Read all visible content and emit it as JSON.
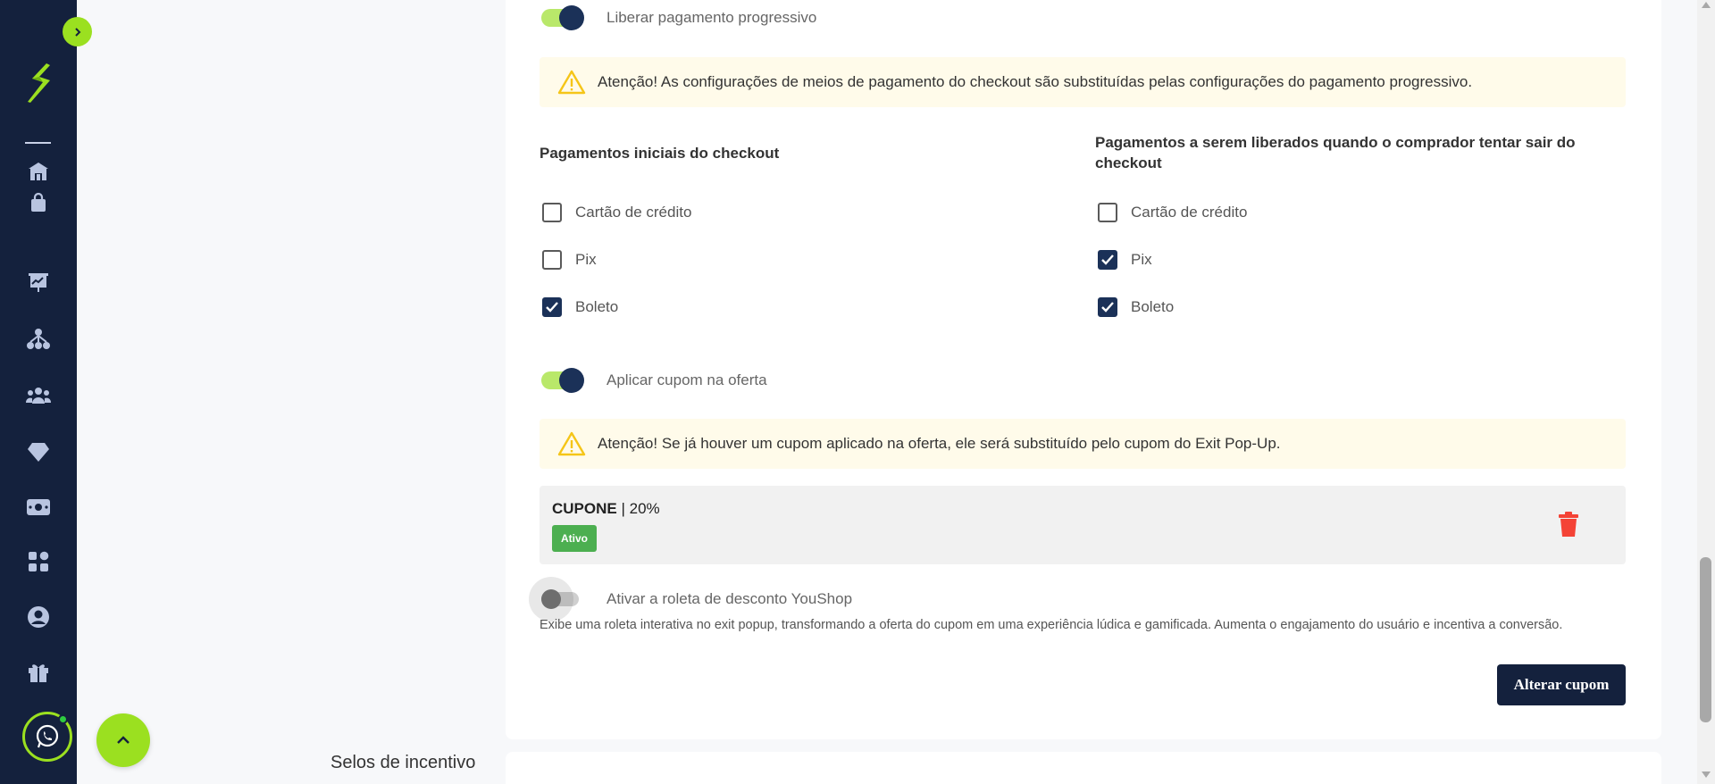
{
  "sidebar": {
    "nav_items": [
      {
        "icon": "home-icon"
      },
      {
        "icon": "shopping-bag-icon"
      },
      {
        "icon": "presentation-chart-icon"
      },
      {
        "icon": "network-icon"
      },
      {
        "icon": "users-group-icon"
      },
      {
        "icon": "diamond-icon"
      },
      {
        "icon": "money-icon"
      },
      {
        "icon": "apps-grid-icon"
      },
      {
        "icon": "user-circle-icon"
      },
      {
        "icon": "gift-icon"
      }
    ]
  },
  "progressive_payment": {
    "toggle_label": "Liberar pagamento progressivo",
    "enabled": true,
    "alert": "Atenção! As configurações de meios de pagamento do checkout são substituídas pelas configurações do pagamento progressivo."
  },
  "payments": {
    "initial": {
      "title": "Pagamentos iniciais do checkout",
      "options": [
        {
          "label": "Cartão de crédito",
          "checked": false
        },
        {
          "label": "Pix",
          "checked": false
        },
        {
          "label": "Boleto",
          "checked": true
        }
      ]
    },
    "released": {
      "title": "Pagamentos a serem liberados quando o comprador tentar sair do checkout",
      "options": [
        {
          "label": "Cartão de crédito",
          "checked": false
        },
        {
          "label": "Pix",
          "checked": true
        },
        {
          "label": "Boleto",
          "checked": true
        }
      ]
    }
  },
  "coupon": {
    "toggle_label": "Aplicar cupom na oferta",
    "enabled": true,
    "alert": "Atenção! Se já houver um cupom aplicado na oferta, ele será substituído pelo cupom do Exit Pop-Up.",
    "code": "CUPONE",
    "separator": " | ",
    "discount": "20%",
    "status": "Ativo"
  },
  "roulette": {
    "toggle_label": "Ativar a roleta de desconto YouShop",
    "enabled": false,
    "description": "Exibe uma roleta interativa no exit popup, transformando a oferta do cupom em uma experiência lúdica e gamificada. Aumenta o engajamento do usuário e incentiva a conversão."
  },
  "actions": {
    "change_coupon": "Alterar cupom"
  },
  "next_section": {
    "title": "Selos de incentivo"
  },
  "colors": {
    "sidebar": "#14213d",
    "accent": "#9be020",
    "primary": "#1b3158",
    "alert_bg": "#fffbea",
    "warning": "#f5c518",
    "danger": "#f44336",
    "success": "#4caf50"
  }
}
